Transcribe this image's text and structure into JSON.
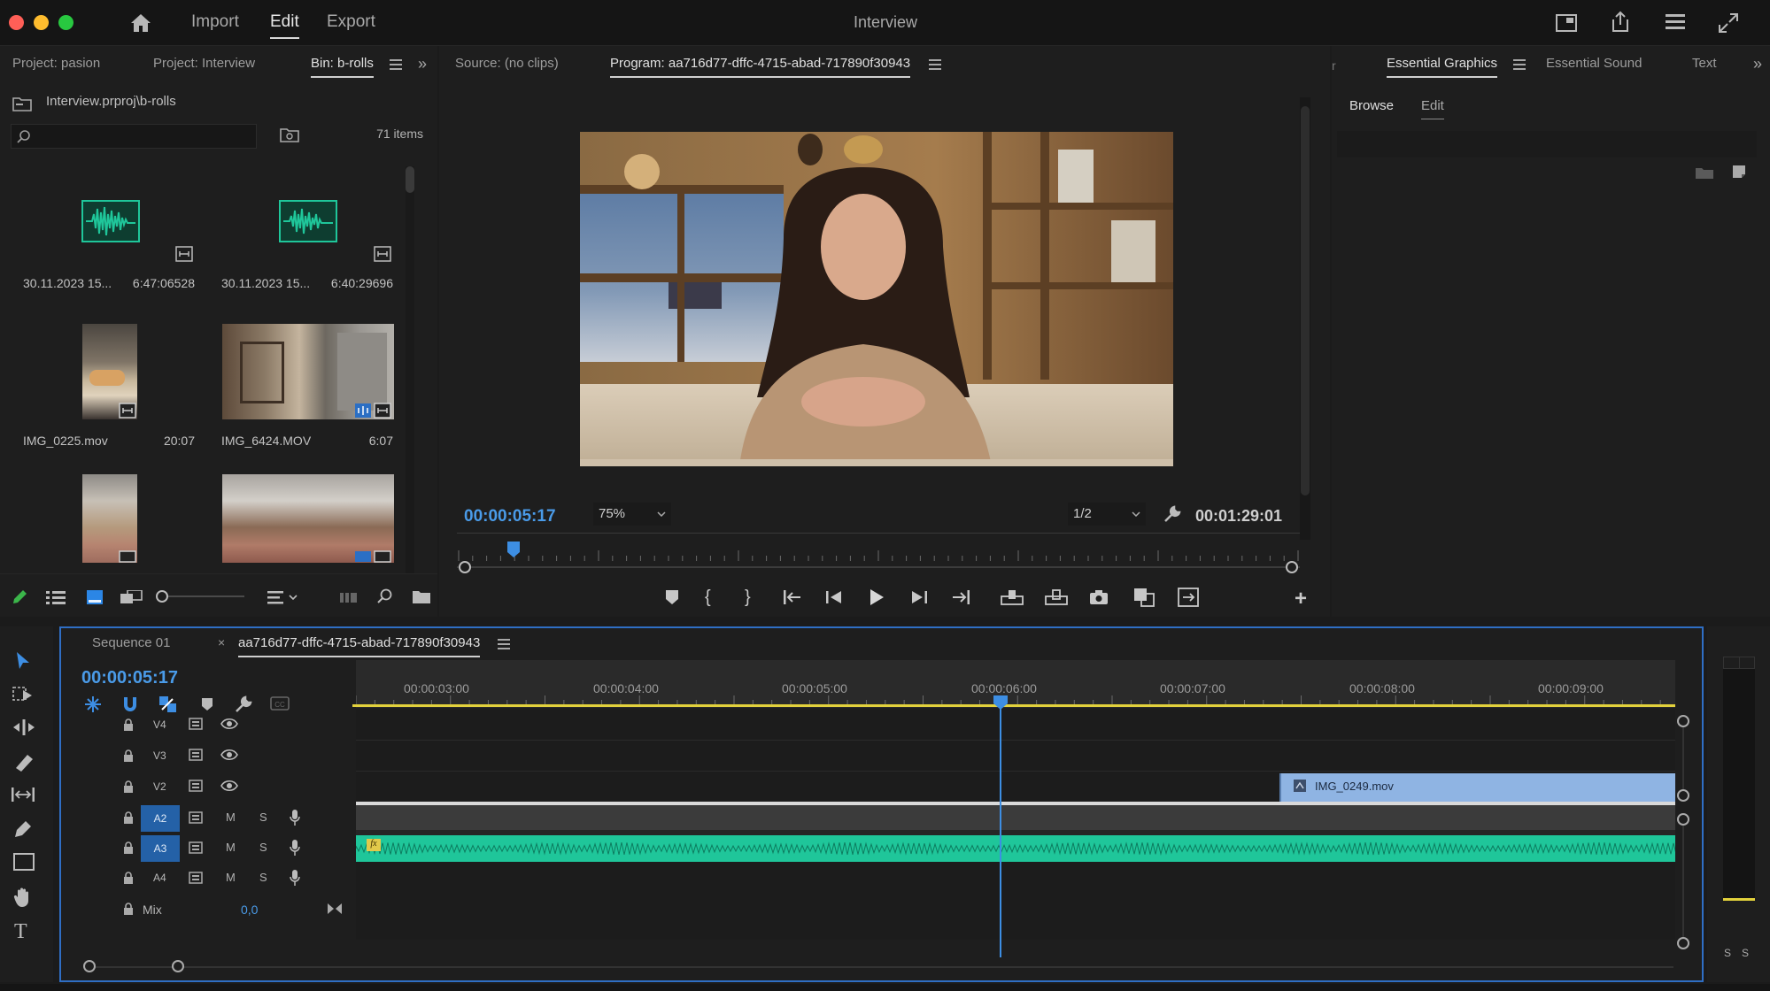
{
  "window": {
    "title": "Interview"
  },
  "topnav": {
    "import": "Import",
    "edit": "Edit",
    "export": "Export"
  },
  "project": {
    "tabs": [
      "Project: pasion",
      "Project: Interview",
      "Bin: b-rolls"
    ],
    "path": "Interview.prproj\\b-rolls",
    "items_count": "71 items",
    "search_placeholder": "",
    "clips": [
      {
        "name": "30.11.2023 15...",
        "duration": "6:47:06528",
        "type": "audio"
      },
      {
        "name": "30.11.2023 15...",
        "duration": "6:40:29696",
        "type": "audio"
      },
      {
        "name": "IMG_0225.mov",
        "duration": "20:07",
        "type": "video"
      },
      {
        "name": "IMG_6424.MOV",
        "duration": "6:07",
        "type": "video"
      },
      {
        "name": "",
        "duration": "",
        "type": "video"
      },
      {
        "name": "",
        "duration": "",
        "type": "video"
      }
    ]
  },
  "monitor": {
    "source_tab": "Source: (no clips)",
    "program_tab": "Program: aa716d77-dffc-4715-abad-717890f30943",
    "timecode": "00:00:05:17",
    "zoom": "75%",
    "resolution": "1/2",
    "duration": "00:01:29:01",
    "playhead_fraction": 0.06
  },
  "essential": {
    "tabs": [
      "Essential Graphics",
      "Essential Sound",
      "Text"
    ],
    "subtabs": [
      "Browse",
      "Edit"
    ]
  },
  "timeline": {
    "tabs": [
      "Sequence 01",
      "aa716d77-dffc-4715-abad-717890f30943"
    ],
    "timecode": "00:00:05:17",
    "ruler": [
      "00:00:03:00",
      "00:00:04:00",
      "00:00:05:00",
      "00:00:06:00",
      "00:00:07:00",
      "00:00:08:00",
      "00:00:09:00"
    ],
    "tracks": [
      {
        "name": "V4",
        "kind": "video"
      },
      {
        "name": "V3",
        "kind": "video"
      },
      {
        "name": "V2",
        "kind": "video"
      },
      {
        "name": "A2",
        "kind": "audio"
      },
      {
        "name": "A3",
        "kind": "audio"
      },
      {
        "name": "A4",
        "kind": "audio"
      }
    ],
    "mute_label": "M",
    "solo_label": "S",
    "mix_label": "Mix",
    "mix_value": "0,0",
    "clip_v2": "IMG_0249.mov",
    "fx_badge": "fx"
  },
  "meter": {
    "labels": [
      "S",
      "S"
    ]
  },
  "colors": {
    "accent_blue": "#4a9be8",
    "audio_green": "#1fc69a",
    "video_clip": "#8fb4e3",
    "work_area_yellow": "#e2d13c"
  }
}
